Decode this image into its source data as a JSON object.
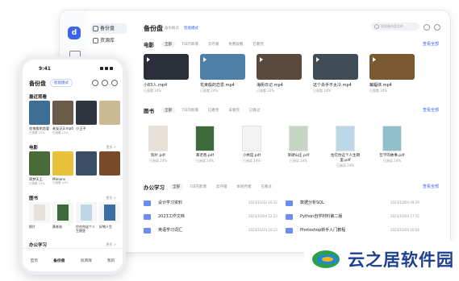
{
  "desktop": {
    "title": "备份盘",
    "tabs": [
      "备份概况",
      "智能模式"
    ],
    "search_placeholder": "搜索备份盘文件",
    "nav": [
      {
        "label": "备份盘"
      },
      {
        "label": "资源库"
      }
    ],
    "video_section": {
      "title": "电影",
      "chips": [
        "全部",
        "7日内新增",
        "云存储",
        "免费观看",
        "已看完"
      ],
      "see_all": "查看全部",
      "items": [
        {
          "title": "小83人.mp4",
          "sub": "已观看 24%",
          "color": "#2b2f3a"
        },
        {
          "title": "花束般的恋爱.mp4",
          "sub": "已观看 24%",
          "color": "#4e7fa6"
        },
        {
          "title": "海街日记.mp4",
          "sub": "已观看 32%",
          "color": "#5a4a3e"
        },
        {
          "title": "这个杀手不太冷.mp4",
          "sub": "已观看 24%",
          "color": "#3f4b55"
        },
        {
          "title": "蝙蝠侠.mp4",
          "sub": "已观看 24%",
          "color": "#7a5a2e"
        }
      ]
    },
    "book_section": {
      "title": "图书",
      "chips": [
        "全部",
        "7日内新增",
        "已看完",
        "未看完",
        "已看过"
      ],
      "see_all": "查看全部",
      "items": [
        {
          "title": "照片.pdf",
          "sub": "已阅读 24%",
          "color": "#e7e2d8"
        },
        {
          "title": "黄老爸.pdf",
          "sub": "已阅读 24%",
          "color": "#3c6a3b"
        },
        {
          "title": "小林是.pdf",
          "sub": "已阅读 24%",
          "color": "#f3f3f3"
        },
        {
          "title": "肝硬山庄.pdf",
          "sub": "已阅读 24%",
          "color": "#c7d6c4"
        },
        {
          "title": "住在你这个人生期里.pdf",
          "sub": "已阅读 24%",
          "color": "#bcd8e6"
        },
        {
          "title": "哲学的故事.pdf",
          "sub": "已阅读 24%",
          "color": "#8fc0cc"
        }
      ]
    },
    "doc_section": {
      "title": "办公学习",
      "chips": [
        "全部",
        "7日内新增",
        "云存储",
        "本地存储",
        "已看过"
      ],
      "see_all": "查看全部",
      "left": [
        {
          "name": "设计学习资料",
          "date": "2023/10/12 16:32"
        },
        {
          "name": "2023工作文档",
          "date": "2023/10/04 12:23"
        },
        {
          "name": "英语学习词汇",
          "date": "2023/10/24 10:13"
        }
      ],
      "right": [
        {
          "name": "数据分析SQL",
          "date": "2023/10/04 09:29"
        },
        {
          "name": "Python自学材料第二版",
          "date": "2023/10/04 17:15"
        },
        {
          "name": "Photoshop新手入门教程",
          "date": "2023/10/04 16:04"
        }
      ]
    }
  },
  "phone": {
    "time": "9:41",
    "title": "备份盘",
    "pill": "智能模式",
    "recent": {
      "title": "最近观看",
      "items": [
        {
          "title": "花束般的恋爱",
          "sub": "已观看 24%",
          "color": "#3d6e94"
        },
        {
          "title": "老友记3.mp4",
          "sub": "已观看 24%",
          "color": "#6b5c4a"
        },
        {
          "title": "小王子",
          "sub": "",
          "color": "#2f3640"
        },
        {
          "title": "",
          "sub": "",
          "color": "#c9b892"
        }
      ]
    },
    "movies": {
      "title": "电影",
      "more": "更多 >",
      "items": [
        {
          "title": "寄梦天王",
          "sub": "已观看 24%",
          "color": "#4b6a3a"
        },
        {
          "title": "Minions",
          "sub": "已观看 24%",
          "color": "#e9c13a"
        },
        {
          "title": "",
          "sub": "",
          "color": "#3a4f66"
        },
        {
          "title": "",
          "sub": "",
          "color": "#7a4a2a"
        }
      ]
    },
    "books": {
      "title": "图书",
      "more": "更多 >",
      "items": [
        {
          "title": "照片",
          "color": "#e7e2d8"
        },
        {
          "title": "黄老爸",
          "color": "#3c6a3b"
        },
        {
          "title": "住在你这个人生期里",
          "color": "#bcd8e6"
        },
        {
          "title": "好物人生",
          "color": "#3a6fa8"
        }
      ]
    },
    "office": {
      "title": "办公学习",
      "more": "更多 >"
    },
    "tabbar": [
      "首页",
      "备份盘",
      "资源库",
      "我的"
    ],
    "active_tab": "备份盘"
  },
  "watermark": {
    "text": "云之居软件园"
  },
  "colors": {
    "accent": "#3a63f0",
    "folder": "#6b8df2"
  }
}
